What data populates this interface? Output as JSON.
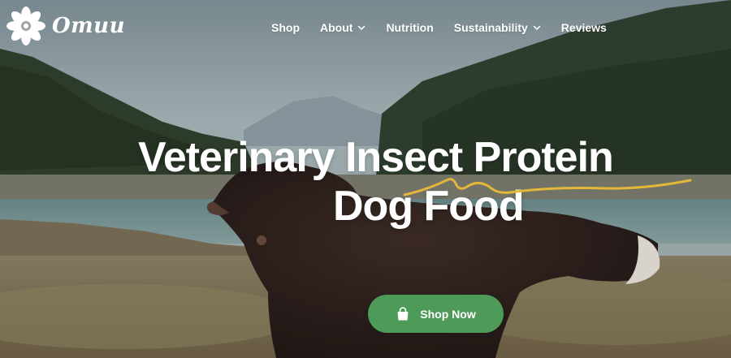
{
  "brand": {
    "name": "Omuu",
    "logo_icon": "flower-logo-icon"
  },
  "nav": {
    "items": [
      {
        "label": "Shop",
        "has_dropdown": false
      },
      {
        "label": "About",
        "has_dropdown": true
      },
      {
        "label": "Nutrition",
        "has_dropdown": false
      },
      {
        "label": "Sustainability",
        "has_dropdown": true
      },
      {
        "label": "Reviews",
        "has_dropdown": false
      }
    ]
  },
  "hero": {
    "title_line_1": "Veterinary Insect Protein",
    "title_line_2": "Dog Food",
    "squiggle_color": "#e2b73a",
    "cta_label": "Shop Now",
    "cta_icon": "shopping-bag-icon",
    "cta_color": "#4e9b59"
  }
}
